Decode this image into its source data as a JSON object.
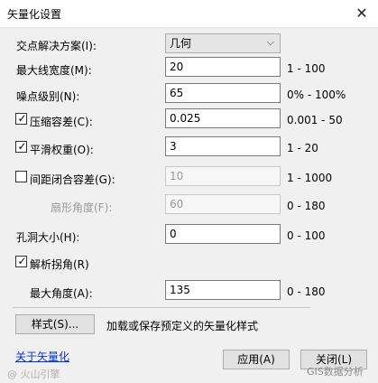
{
  "window": {
    "title": "矢量化设置",
    "close": "✕"
  },
  "rows": {
    "intersection": {
      "label": "交点解决方案(I):",
      "value": "几何",
      "chevron": "⌵"
    },
    "max_line_width": {
      "label": "最大线宽度(M):",
      "value": "20",
      "range": "1 - 100"
    },
    "noise_level": {
      "label": "噪点级别(N):",
      "value": "65",
      "range": "0% - 100%"
    },
    "compression": {
      "label": "压缩容差(C):",
      "checked": true,
      "value": "0.025",
      "range": "0.001 - 50"
    },
    "smoothing": {
      "label": "平滑权重(O):",
      "checked": true,
      "value": "3",
      "range": "1 - 20"
    },
    "gap_closure": {
      "label": "间距闭合容差(G):",
      "checked": false,
      "value": "10",
      "range": "1 - 1000"
    },
    "fan_angle": {
      "label": "扇形角度(F):",
      "value": "60",
      "range": "0 - 180"
    },
    "hole_size": {
      "label": "孔洞大小(H):",
      "value": "0",
      "range": "0 - 100"
    },
    "resolve_corners": {
      "label": "解析拐角(R)",
      "checked": true
    },
    "max_angle": {
      "label": "最大角度(A):",
      "value": "135",
      "range": "0 - 180"
    }
  },
  "styles": {
    "button": "样式(S)...",
    "description": "加载或保存预定义的矢量化样式"
  },
  "footer": {
    "about_link": "关于矢量化",
    "apply_button": "应用(A)",
    "close_button": "关闭(L)",
    "watermark_right": "GIS数据分析",
    "watermark_left": "@ 火山引擎"
  },
  "checkmark": "✓"
}
